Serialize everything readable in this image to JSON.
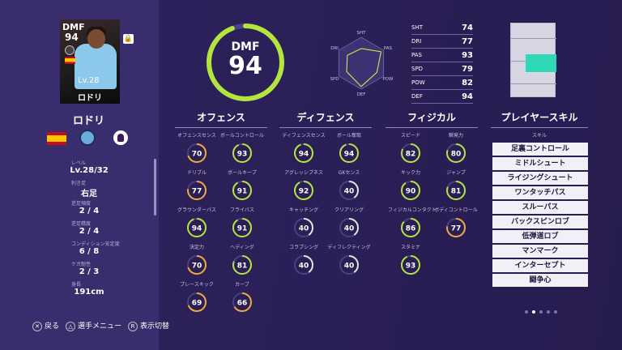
{
  "card": {
    "position": "DMF",
    "overall": "94",
    "level": "Lv.28",
    "name": "ロドリ"
  },
  "player": {
    "name": "ロドリ"
  },
  "info": [
    {
      "label": "レベル",
      "value": "Lv.28/32"
    },
    {
      "label": "利き足",
      "value": "右足"
    },
    {
      "label": "逆足頻度",
      "value": "2 / 4"
    },
    {
      "label": "逆足精度",
      "value": "2 / 4"
    },
    {
      "label": "コンディション安定度",
      "value": "6 / 8"
    },
    {
      "label": "ケガ耐性",
      "value": "2 / 3"
    },
    {
      "label": "身長",
      "value": "191cm"
    }
  ],
  "ring": {
    "position": "DMF",
    "overall": "94",
    "fill": 0.94,
    "color": "#b3e53d"
  },
  "radar": {
    "labels": [
      "SHT",
      "PAS",
      "POW",
      "DEF",
      "SPD",
      "DRI"
    ],
    "values": [
      74,
      93,
      82,
      94,
      79,
      77
    ]
  },
  "stats_table": [
    {
      "label": "SHT",
      "value": "74"
    },
    {
      "label": "DRI",
      "value": "77"
    },
    {
      "label": "PAS",
      "value": "93"
    },
    {
      "label": "SPD",
      "value": "79"
    },
    {
      "label": "POW",
      "value": "82"
    },
    {
      "label": "DEF",
      "value": "94"
    }
  ],
  "sections": {
    "offense": "オフェンス",
    "defense": "ディフェンス",
    "physical": "フィジカル",
    "skills": "プレイヤースキル",
    "skills_sub": "スキル"
  },
  "offense": [
    {
      "label": "オフェンスセンス",
      "value": 70
    },
    {
      "label": "ボールコントロール",
      "value": 93
    },
    {
      "label": "ドリブル",
      "value": 77
    },
    {
      "label": "ボールキープ",
      "value": 91
    },
    {
      "label": "グラウンダーパス",
      "value": 94
    },
    {
      "label": "フライパス",
      "value": 91
    },
    {
      "label": "決定力",
      "value": 70
    },
    {
      "label": "ヘディング",
      "value": 81
    },
    {
      "label": "プレースキック",
      "value": 69
    },
    {
      "label": "カーブ",
      "value": 66
    }
  ],
  "defense": [
    {
      "label": "ディフェンスセンス",
      "value": 94
    },
    {
      "label": "ボール奪取",
      "value": 94
    },
    {
      "label": "アグレッシブネス",
      "value": 92
    },
    {
      "label": "GKセンス",
      "value": 40
    },
    {
      "label": "キャッチング",
      "value": 40
    },
    {
      "label": "クリアリング",
      "value": 40
    },
    {
      "label": "コラプシング",
      "value": 40
    },
    {
      "label": "ディフレクティング",
      "value": 40
    }
  ],
  "physical": [
    {
      "label": "スピード",
      "value": 82
    },
    {
      "label": "瞬発力",
      "value": 80
    },
    {
      "label": "キック力",
      "value": 90
    },
    {
      "label": "ジャンプ",
      "value": 81
    },
    {
      "label": "フィジカルコンタクト",
      "value": 86
    },
    {
      "label": "ボディコントロール",
      "value": 77
    },
    {
      "label": "スタミナ",
      "value": 93
    }
  ],
  "skills": [
    "足裏コントロール",
    "ミドルシュート",
    "ライジングシュート",
    "ワンタッチパス",
    "スルーパス",
    "バックスピンロブ",
    "低弾道ロブ",
    "マンマーク",
    "インターセプト",
    "闘争心"
  ],
  "controls": [
    {
      "icon": "✕",
      "label": "戻る"
    },
    {
      "icon": "△",
      "label": "選手メニュー"
    },
    {
      "icon": "R",
      "label": "表示切替"
    }
  ],
  "colors": {
    "high": "#b3e53d",
    "mid": "#f3a83a",
    "low": "#e3e3e3"
  }
}
